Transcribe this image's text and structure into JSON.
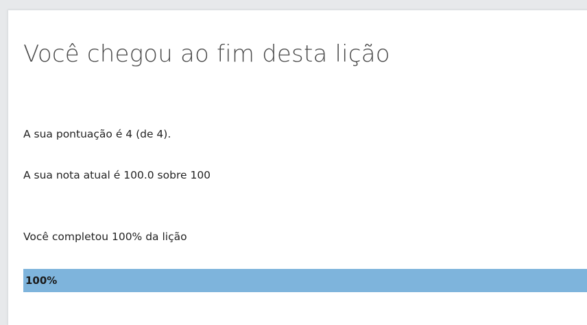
{
  "lesson_end": {
    "title": "Você chegou ao fim desta lição",
    "score_text": "A sua pontuação é 4 (de 4).",
    "grade_text": "A sua nota atual é 100.0 sobre 100",
    "completion_text": "Você completou 100% da lição",
    "progress": {
      "percent": 100,
      "label": "100%"
    }
  },
  "colors": {
    "progress_fill": "#7eb4dc",
    "page_background": "#e7e9eb",
    "card_background": "#ffffff"
  }
}
